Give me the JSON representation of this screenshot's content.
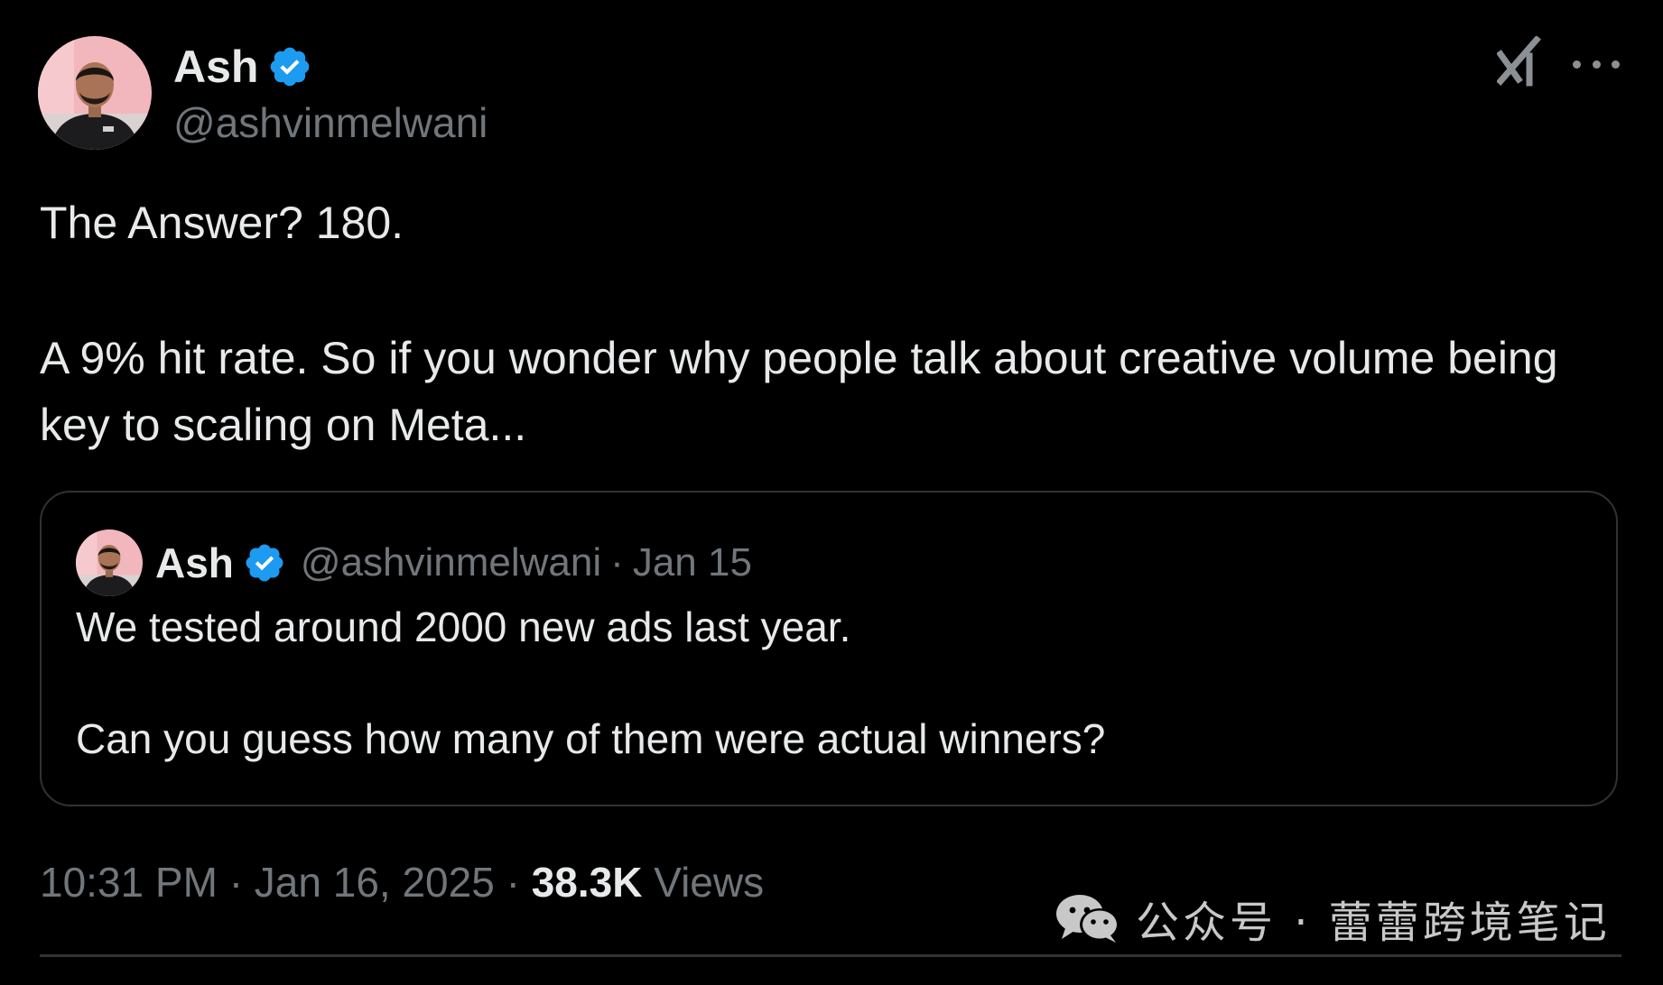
{
  "author": {
    "name": "Ash",
    "handle": "@ashvinmelwani",
    "verified": true
  },
  "icons": {
    "grok": "grok-icon",
    "more": "more-options-icon",
    "verified": "verified-badge-icon",
    "wechat": "wechat-icon"
  },
  "colors": {
    "background": "#000000",
    "text": "#e7e9ea",
    "secondary_text": "#71767b",
    "verified_badge": "#1d9bf0",
    "border": "#2f3336"
  },
  "tweet": {
    "line1": "The Answer? 180.",
    "line2": "A 9% hit rate. So if you wonder why people talk about creative volume being key to scaling on Meta..."
  },
  "quote": {
    "name": "Ash",
    "handle": "@ashvinmelwani",
    "separator": "·",
    "date": "Jan 15",
    "line1": "We tested around 2000 new ads last year.",
    "line2": "Can you guess how many of them were actual winners?"
  },
  "meta": {
    "time": "10:31 PM",
    "separator": "·",
    "date": "Jan 16, 2025",
    "views_count": "38.3K",
    "views_label": "Views"
  },
  "watermark": {
    "text": "公众号 · 蕾蕾跨境笔记"
  }
}
